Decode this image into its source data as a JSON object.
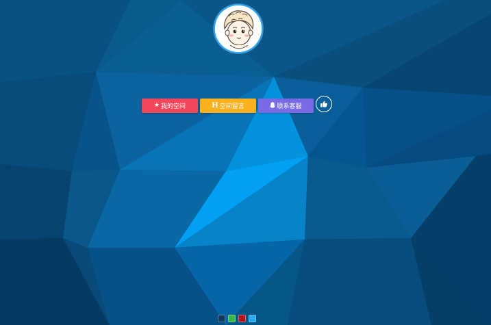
{
  "avatar": {
    "alt": "cartoon-boy-avatar"
  },
  "buttons": {
    "space": {
      "label": "我的空间",
      "icon": "star-icon",
      "color": "#f3465a"
    },
    "message": {
      "label": "空间留言",
      "icon": "h-icon",
      "color": "#f9b21d"
    },
    "contact": {
      "label": "联系客服",
      "icon": "qq-penguin-icon",
      "color": "#7b6ae6"
    },
    "like": {
      "icon": "thumbs-up-icon"
    }
  },
  "theme_swatches": [
    {
      "name": "dark-navy",
      "color": "#0e3a5c"
    },
    {
      "name": "green",
      "color": "#39b54a"
    },
    {
      "name": "red",
      "color": "#b3121b"
    },
    {
      "name": "light-blue",
      "color": "#22a7f0"
    }
  ]
}
